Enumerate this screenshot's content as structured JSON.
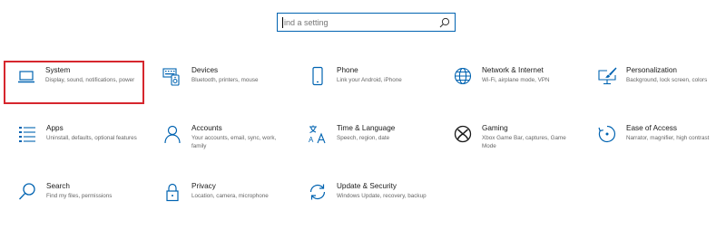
{
  "search": {
    "placeholder": "ind a setting",
    "icon": "search-icon"
  },
  "accent_color": "#0063b1",
  "selection_color": "#d6262d",
  "tiles": [
    {
      "title": "System",
      "desc": "Display, sound, notifications, power",
      "icon": "laptop-icon",
      "selected": true
    },
    {
      "title": "Devices",
      "desc": "Bluetooth, printers, mouse",
      "icon": "keyboard-speaker-icon"
    },
    {
      "title": "Phone",
      "desc": "Link your Android, iPhone",
      "icon": "phone-icon"
    },
    {
      "title": "Network & Internet",
      "desc": "Wi-Fi, airplane mode, VPN",
      "icon": "globe-icon"
    },
    {
      "title": "Personalization",
      "desc": "Background, lock screen, colors",
      "icon": "paintbrush-monitor-icon"
    },
    {
      "title": "Apps",
      "desc": "Uninstall, defaults, optional features",
      "icon": "apps-list-icon"
    },
    {
      "title": "Accounts",
      "desc": "Your accounts, email, sync, work, family",
      "icon": "person-icon"
    },
    {
      "title": "Time & Language",
      "desc": "Speech, region, date",
      "icon": "time-language-icon"
    },
    {
      "title": "Gaming",
      "desc": "Xbox Game Bar, captures, Game Mode",
      "icon": "xbox-icon"
    },
    {
      "title": "Ease of Access",
      "desc": "Narrator, magnifier, high contrast",
      "icon": "ease-of-access-icon"
    },
    {
      "title": "Search",
      "desc": "Find my files, permissions",
      "icon": "search-icon"
    },
    {
      "title": "Privacy",
      "desc": "Location, camera, microphone",
      "icon": "lock-icon"
    },
    {
      "title": "Update & Security",
      "desc": "Windows Update, recovery, backup",
      "icon": "sync-icon"
    }
  ]
}
